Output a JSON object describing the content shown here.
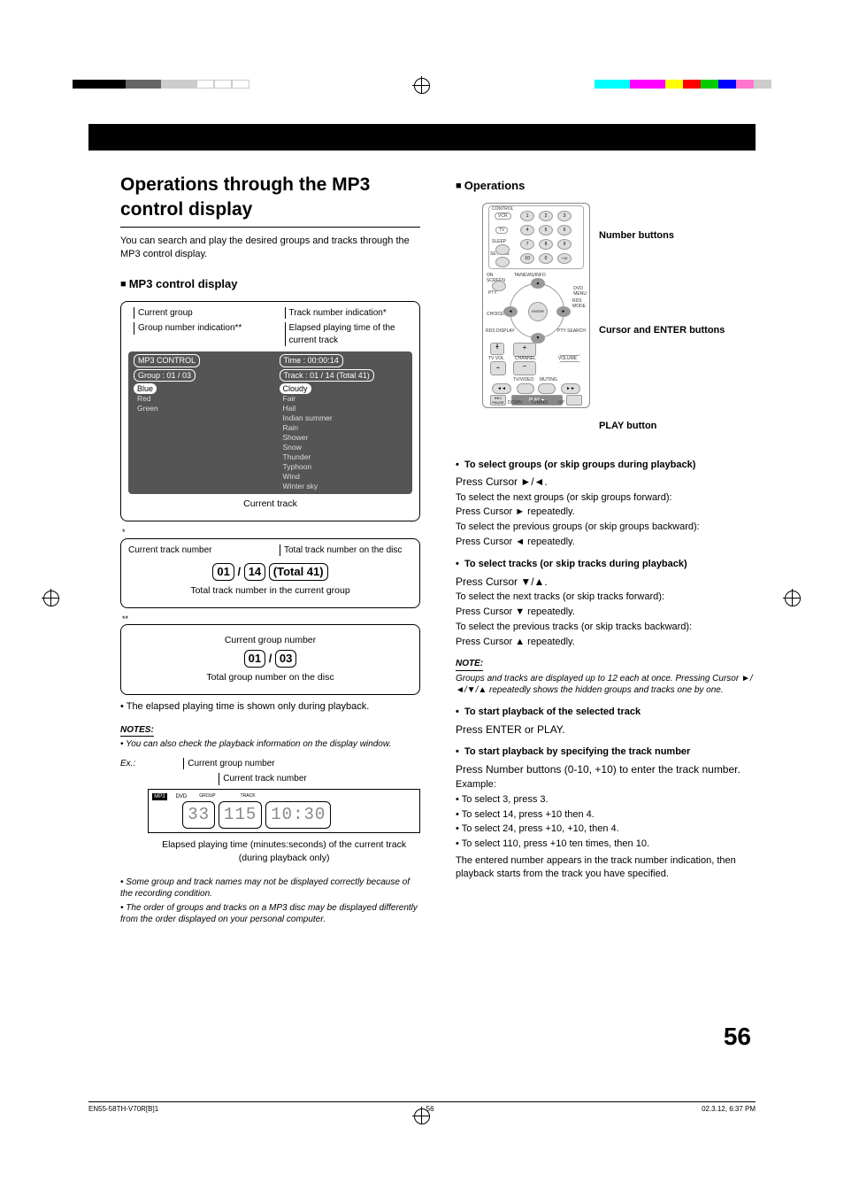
{
  "header": {
    "title": "Operations through the MP3 control display",
    "intro": "You can search and play the desired groups and tracks through the MP3 control display."
  },
  "left": {
    "h2": "MP3 control display",
    "labels": {
      "current_group": "Current group",
      "group_number_indication": "Group number indication**",
      "track_number_indication": "Track number indication*",
      "elapsed_playing": "Elapsed playing time of the current track",
      "current_track": "Current track",
      "current_track_number": "Current track number",
      "total_track_number_disc": "Total track number on the disc",
      "total_track_in_group": "Total track number in the current group",
      "current_group_number": "Current group number",
      "total_group_number_disc": "Total group number on the disc"
    },
    "screen": {
      "title": "MP3 CONTROL",
      "group_line": "Group :   01 / 03",
      "time_line": "Time :   00:00:14",
      "track_line": "Track :   01 / 14 (Total 41)",
      "sel_group": "Blue",
      "groups": [
        "Red",
        "Green"
      ],
      "sel_track": "Cloudy",
      "tracks": [
        "Fair",
        "Hail",
        "Indian summer",
        "Rain",
        "Shower",
        "Snow",
        "Thunder",
        "Typhoon",
        "Wind",
        "Winter sky"
      ]
    },
    "frac1": {
      "a": "01",
      "b": "14",
      "c": "(Total 41)"
    },
    "frac2": {
      "a": "01",
      "b": "03"
    },
    "elapsed_note": "The elapsed playing time is shown only during playback.",
    "notes_hdr": "NOTES:",
    "note1": "You can also check the playback information on the display window.",
    "ex_label": "Ex.:",
    "ex_current_group": "Current group number",
    "ex_current_track": "Current track number",
    "lcd": {
      "mp3": "MP3",
      "dvd": "DVD",
      "group": "GROUP",
      "track": "TRACK",
      "g": "33",
      "t": "115",
      "time": "10:30"
    },
    "ex_caption": "Elapsed playing time (minutes:seconds) of the current track  (during playback only)",
    "note2": "Some group and track names may not be displayed correctly because of the recording condition.",
    "note3": "The order of groups and tracks on a MP3 disc may be displayed differently from the order displayed on your personal computer."
  },
  "right": {
    "h2": "Operations",
    "remote": {
      "number_buttons": "Number buttons",
      "cursor_enter": "Cursor and ENTER buttons",
      "play_button": "PLAY button"
    },
    "sec1": {
      "title": "To select groups (or skip groups during playback)",
      "cmd": "Press Cursor ►/◄.",
      "l1": "To select the next groups (or skip groups forward):",
      "l2": "Press Cursor ► repeatedly.",
      "l3": "To select the previous groups (or skip groups backward):",
      "l4": "Press Cursor ◄ repeatedly."
    },
    "sec2": {
      "title": "To select tracks (or skip tracks during playback)",
      "cmd": "Press Cursor ▼/▲.",
      "l1": "To select the next tracks (or skip tracks forward):",
      "l2": "Press Cursor ▼ repeatedly.",
      "l3": "To select the previous tracks (or skip tracks backward):",
      "l4": "Press Cursor ▲ repeatedly."
    },
    "note_hdr": "NOTE:",
    "note_body": "Groups and tracks are displayed up to 12 each at once. Pressing Cursor ►/◄/▼/▲ repeatedly shows the hidden groups and tracks one by one.",
    "sec3": {
      "title": "To start playback of the selected track",
      "cmd": "Press ENTER or PLAY."
    },
    "sec4": {
      "title": "To start playback by specifying the track number",
      "cmd": "Press Number buttons (0-10, +10) to enter the track number.",
      "ex": "Example:",
      "e1": "To select 3, press 3.",
      "e2": "To select 14, press +10 then 4.",
      "e3": "To select 24, press +10, +10, then 4.",
      "e4": "To select 110, press +10 ten times, then 10.",
      "tail": "The entered number appears in the track number indication, then playback starts from the track you have specified."
    }
  },
  "page_number": "56",
  "footer": {
    "left": "EN55-58TH-V70R[B]1",
    "mid": "56",
    "right": "02.3.12, 6:37 PM"
  }
}
